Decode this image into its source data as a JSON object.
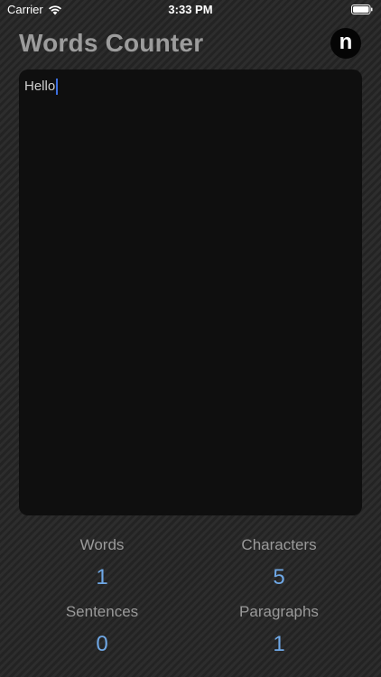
{
  "status_bar": {
    "carrier": "Carrier",
    "time": "3:33 PM",
    "wifi_icon": "wifi-icon",
    "battery_icon": "battery-icon"
  },
  "header": {
    "title": "Words Counter",
    "logo_letter": "n"
  },
  "editor": {
    "text": "Hello"
  },
  "stats": {
    "words": {
      "label": "Words",
      "value": "1"
    },
    "characters": {
      "label": "Characters",
      "value": "5"
    },
    "sentences": {
      "label": "Sentences",
      "value": "0"
    },
    "paragraphs": {
      "label": "Paragraphs",
      "value": "1"
    }
  },
  "colors": {
    "title": "#9c9c9c",
    "value": "#6fa8e6",
    "label": "#9a9a9a",
    "caret": "#3d6fe0",
    "panel": "#0f0f0f"
  }
}
